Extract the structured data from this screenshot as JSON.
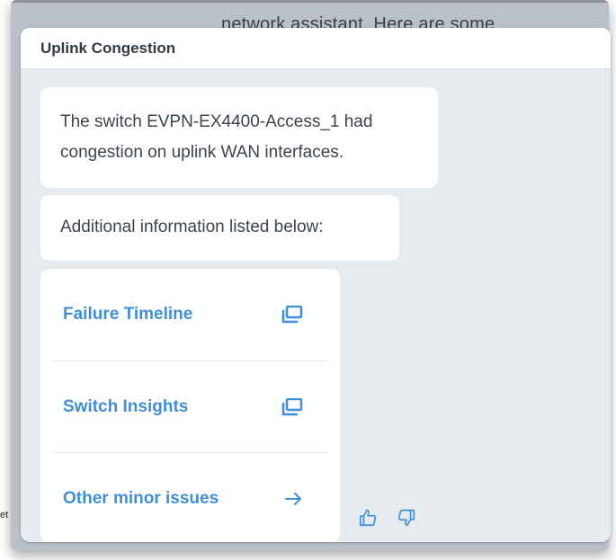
{
  "background": {
    "partial_text": "network assistant. Here are some",
    "side_text": "et"
  },
  "card": {
    "title": "Uplink Congestion",
    "messages": [
      "The switch EVPN-EX4400-Access_1 had congestion on uplink WAN interfaces.",
      "Additional information listed below:"
    ],
    "links": [
      {
        "label": "Failure Timeline",
        "icon": "popout-icon"
      },
      {
        "label": "Switch Insights",
        "icon": "popout-icon"
      },
      {
        "label": "Other minor issues",
        "icon": "arrow-right-icon"
      }
    ],
    "feedback": {
      "up_icon": "thumbs-up-icon",
      "down_icon": "thumbs-down-icon"
    }
  },
  "colors": {
    "accent": "#3f8fd8",
    "card_bg": "#e6ebf0",
    "text": "#3d434c"
  }
}
